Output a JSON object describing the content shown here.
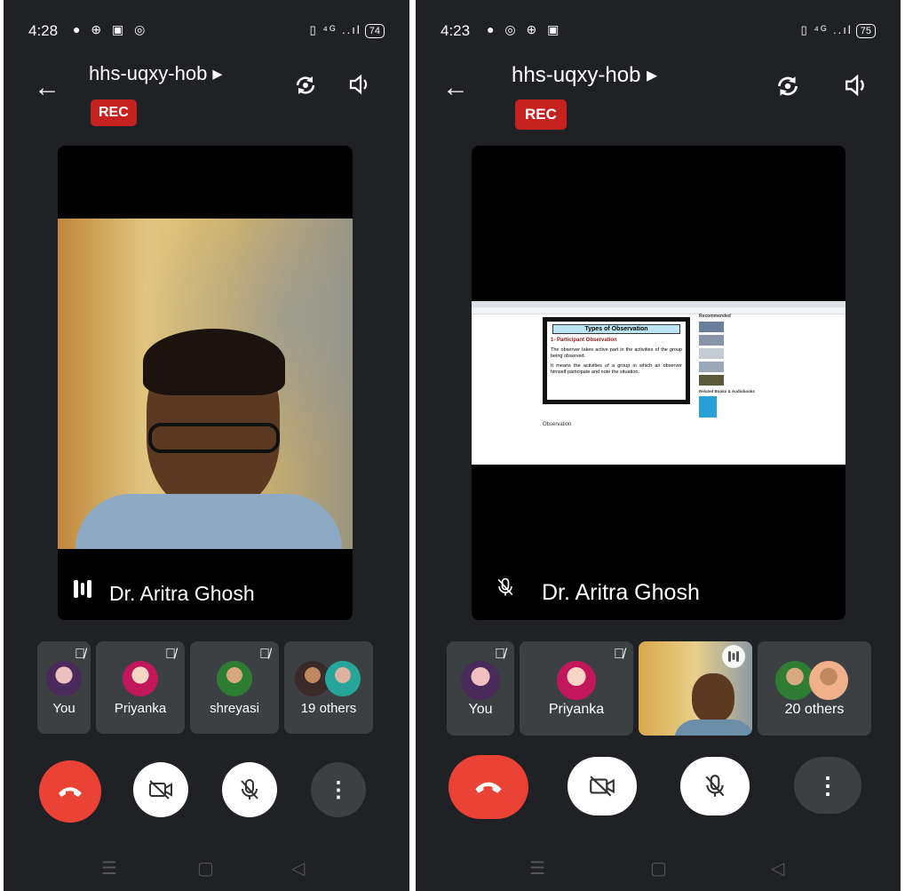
{
  "left": {
    "status": {
      "time": "4:28",
      "battery": "74"
    },
    "header": {
      "title": "hhs-uqxy-hob ▸",
      "rec": "REC"
    },
    "main": {
      "speaker": "Dr. Aritra Ghosh"
    },
    "thumbs": [
      {
        "name": "You"
      },
      {
        "name": "Priyanka"
      },
      {
        "name": "shreyasi"
      },
      {
        "name": "19 others"
      }
    ]
  },
  "right": {
    "status": {
      "time": "4:23",
      "battery": "75"
    },
    "header": {
      "title": "hhs-uqxy-hob ▸",
      "rec": "REC"
    },
    "main": {
      "speaker": "Dr. Aritra Ghosh"
    },
    "slide": {
      "title": "Types of Observation",
      "heading": "1- Participant Observation",
      "bullet1": "The observer takes active part in the activities of the group being observed.",
      "bullet2": "It means the activities of a group in which an observer himself participate and note the situation.",
      "sidebar_title": "Recommended",
      "related": "Related Books & Audiobooks",
      "below_title": "Observation"
    },
    "thumbs": [
      {
        "name": "You"
      },
      {
        "name": "Priyanka"
      },
      {
        "name": "20 others"
      }
    ]
  },
  "colors": {
    "end_call": "#ea4335",
    "rec": "#c5221f",
    "tile": "#3c4043",
    "bg": "#202124"
  }
}
